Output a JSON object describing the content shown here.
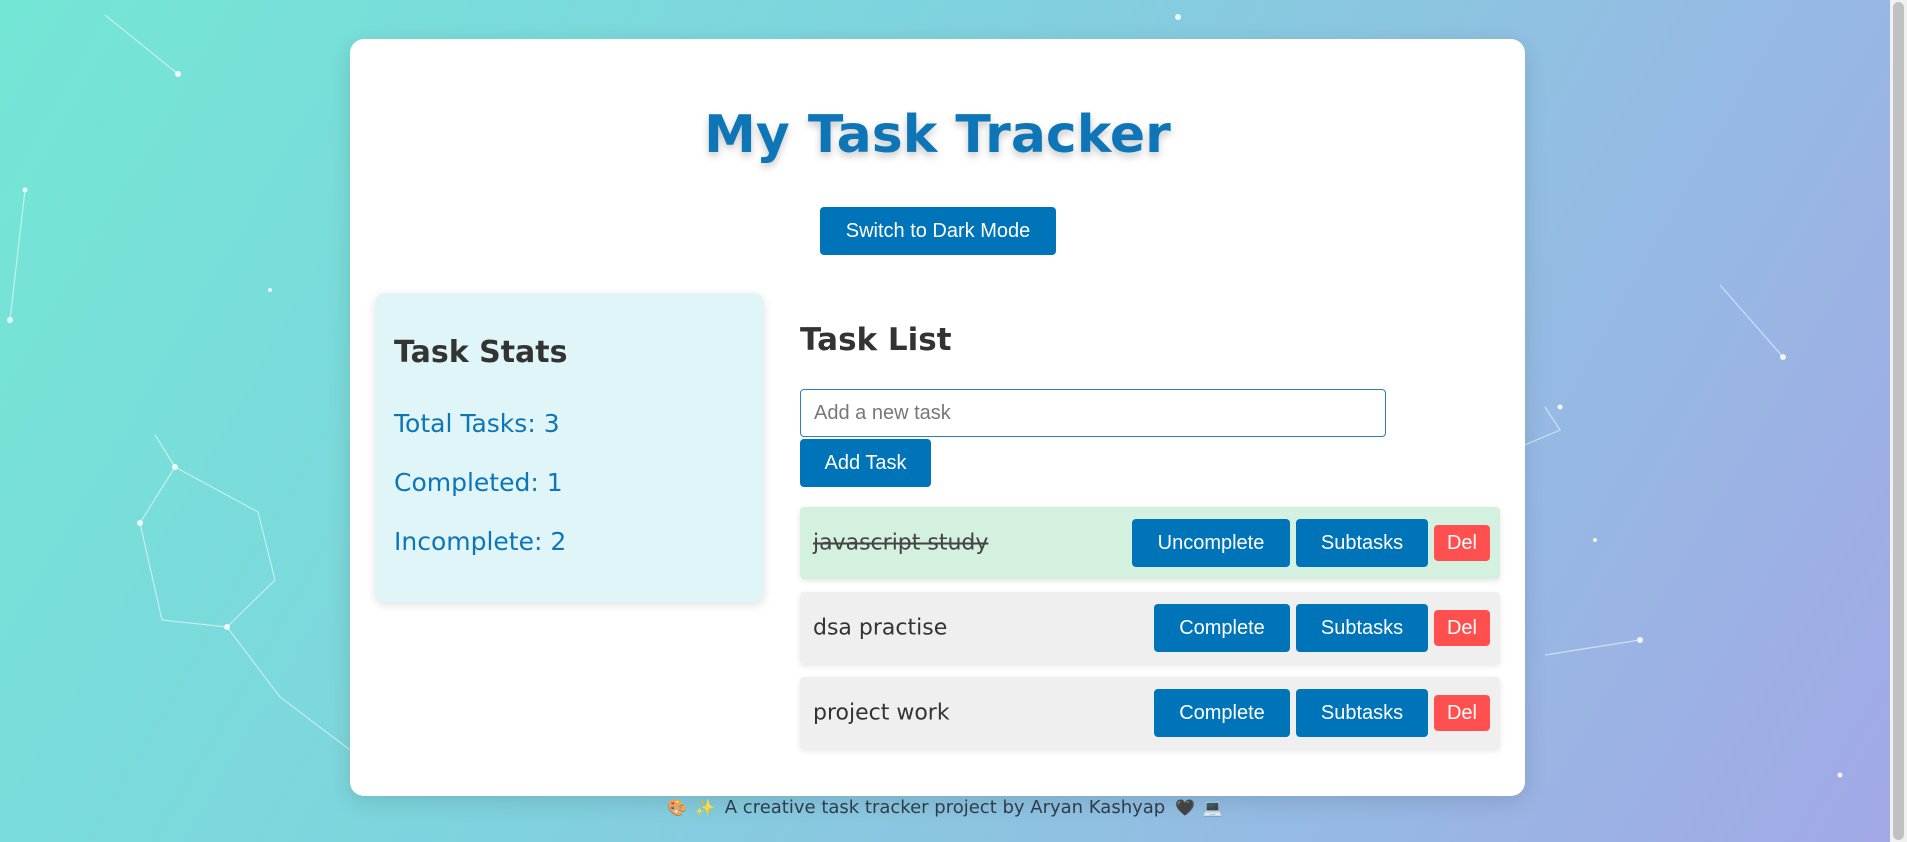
{
  "app": {
    "title": "My Task Tracker",
    "theme_toggle_label": "Switch to Dark Mode"
  },
  "stats": {
    "heading": "Task Stats",
    "total_label": "Total Tasks:",
    "total_value": "3",
    "completed_label": "Completed:",
    "completed_value": "1",
    "incomplete_label": "Incomplete:",
    "incomplete_value": "2"
  },
  "task_list": {
    "heading": "Task List",
    "input_placeholder": "Add a new task",
    "input_value": "",
    "add_label": "Add Task",
    "tasks": [
      {
        "name": "javascript study",
        "completed": true,
        "toggle_label": "Uncomplete",
        "subtasks_label": "Subtasks",
        "delete_label": "Del"
      },
      {
        "name": "dsa practise",
        "completed": false,
        "toggle_label": "Complete",
        "subtasks_label": "Subtasks",
        "delete_label": "Del"
      },
      {
        "name": "project work",
        "completed": false,
        "toggle_label": "Complete",
        "subtasks_label": "Subtasks",
        "delete_label": "Del"
      }
    ]
  },
  "footer": {
    "text": "A creative task tracker project by Aryan Kashyap",
    "icons": [
      "palette-icon",
      "sparkles-icon",
      "heart-icon",
      "computer-icon"
    ]
  },
  "colors": {
    "primary": "#0074b8",
    "title": "#0e76b6",
    "danger": "#ff4f4f",
    "completed_bg": "#d4f0df",
    "stats_bg": "#dff5f7"
  }
}
